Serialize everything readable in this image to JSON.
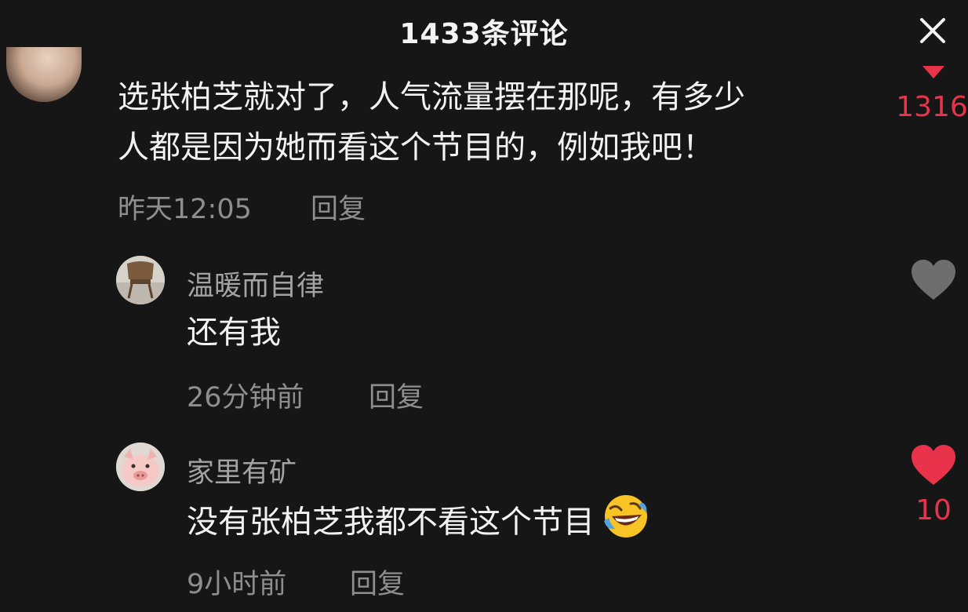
{
  "header": {
    "title": "1433条评论",
    "close_label": "×"
  },
  "comments": [
    {
      "text_line1": "选张柏芝就对了，人气流量摆在那呢，有多少",
      "text_line2": "人都是因为她而看这个节目的，例如我吧！",
      "time": "昨天12:05",
      "reply_label": "回复",
      "like_count": "1316",
      "liked": true
    },
    {
      "username": "温暖而自律",
      "text": "还有我",
      "time": "26分钟前",
      "reply_label": "回复",
      "like_count": "",
      "liked": false
    },
    {
      "username": "家里有矿",
      "text": "没有张柏芝我都不看这个节目",
      "emoji": "rolling-on-floor-laughing",
      "time": "9小时前",
      "reply_label": "回复",
      "like_count": "10",
      "liked": true
    }
  ],
  "colors": {
    "background": "#161616",
    "liked_red": "#e8334a",
    "unliked_gray": "#6e6e6e",
    "meta_gray": "#8e8e8e"
  },
  "icons": {
    "close": "close-icon",
    "like": "heart-icon",
    "emoji": "laughing-tears-emoji-icon"
  }
}
